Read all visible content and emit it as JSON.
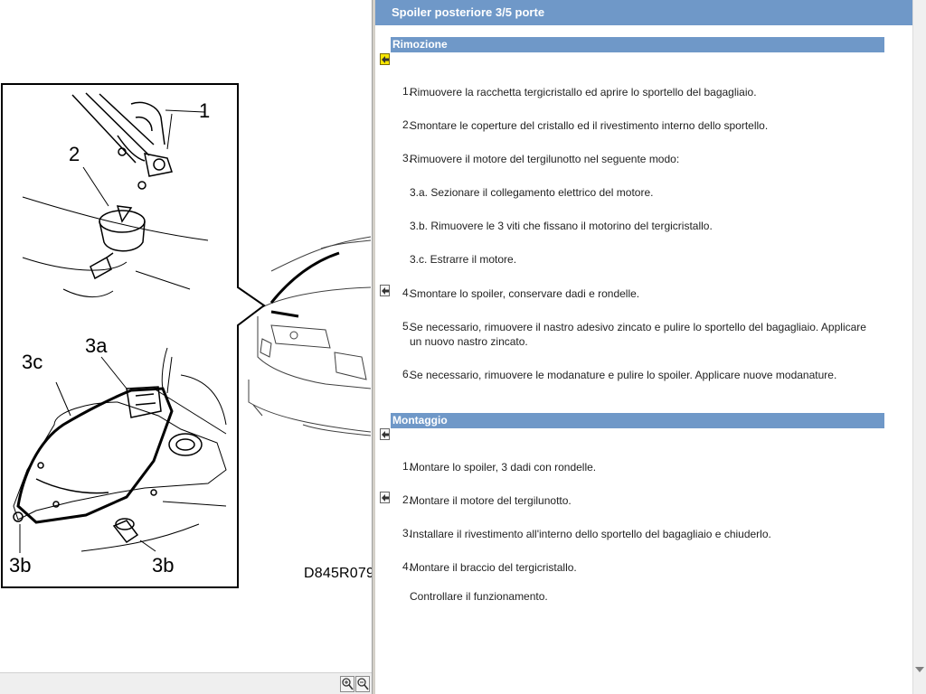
{
  "page_title": "Spoiler posteriore 3/5 porte",
  "figure": {
    "code": "D845R079",
    "callouts": [
      "1",
      "2",
      "3a",
      "3c",
      "3b",
      "3b"
    ]
  },
  "sections": {
    "removal": {
      "title": "Rimozione",
      "steps": [
        {
          "num": "1.",
          "text": "Rimuovere la racchetta tergicristallo ed aprire lo sportello del bagagliaio."
        },
        {
          "num": "2.",
          "text": "Smontare le coperture del cristallo ed il rivestimento interno dello sportello."
        },
        {
          "num": "3.",
          "text": "Rimuovere il motore del tergilunotto nel seguente modo:"
        },
        {
          "num": "",
          "text": "3.a. Sezionare il collegamento elettrico del motore."
        },
        {
          "num": "",
          "text": "3.b. Rimuovere le 3 viti che fissano il motorino del tergicristallo."
        },
        {
          "num": "",
          "text": "3.c. Estrarre il motore."
        },
        {
          "num": "4.",
          "text": "Smontare lo spoiler, conservare dadi e rondelle."
        },
        {
          "num": "5.",
          "text": "Se necessario, rimuovere il nastro adesivo zincato e pulire lo sportello del bagagliaio. Applicare un nuovo nastro zincato."
        },
        {
          "num": "6.",
          "text": "Se necessario, rimuovere le modanature e pulire lo spoiler. Applicare nuove modanature."
        }
      ]
    },
    "installation": {
      "title": "Montaggio",
      "steps": [
        {
          "num": "1.",
          "text": "Montare lo spoiler, 3 dadi con rondelle."
        },
        {
          "num": "2.",
          "text": "Montare il motore del tergilunotto."
        },
        {
          "num": "3.",
          "text": "Installare il rivestimento all'interno dello sportello del bagagliaio e chiuderlo."
        },
        {
          "num": "4.",
          "text": "Montare il braccio del tergicristallo."
        },
        {
          "num": "",
          "text": "Controllare il funzionamento."
        }
      ]
    }
  },
  "icons": {
    "nav_back": "arrow-left-icon",
    "zoom_in": "zoom-in-icon",
    "zoom_out": "zoom-out-icon"
  },
  "colors": {
    "header_blue": "#6f98c8",
    "nav_yellow": "#f6e600"
  }
}
